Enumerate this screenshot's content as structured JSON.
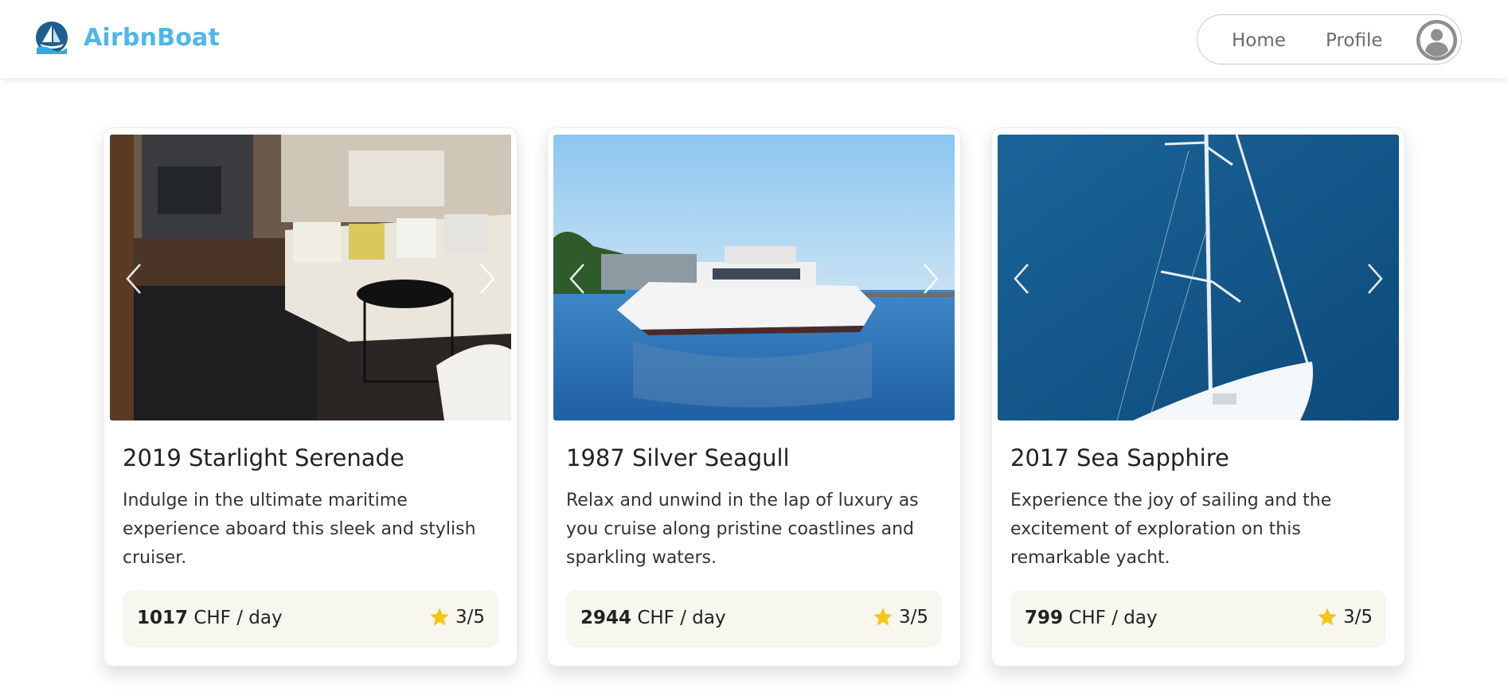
{
  "header": {
    "brand_name": "AirbnBoat",
    "nav": {
      "home_label": "Home",
      "profile_label": "Profile"
    }
  },
  "listings": [
    {
      "title": "2019 Starlight Serenade",
      "description": "Indulge in the ultimate maritime experience aboard this sleek and stylish cruiser.",
      "price": "1017",
      "price_unit": "CHF / day",
      "rating": "3/5"
    },
    {
      "title": "1987 Silver Seagull",
      "description": "Relax and unwind in the lap of luxury as you cruise along pristine coastlines and sparkling waters.",
      "price": "2944",
      "price_unit": "CHF / day",
      "rating": "3/5"
    },
    {
      "title": "2017 Sea Sapphire",
      "description": "Experience the joy of sailing and the excitement of exploration on this remarkable yacht.",
      "price": "799",
      "price_unit": "CHF / day",
      "rating": "3/5"
    }
  ],
  "colors": {
    "brand": "#4fb6ea",
    "star": "#f5c518",
    "footer_bg": "#f7f6ef"
  },
  "icons": {
    "logo": "sailboat-logo-icon",
    "avatar": "user-avatar-icon",
    "star": "star-icon",
    "prev": "chevron-left-icon",
    "next": "chevron-right-icon"
  }
}
